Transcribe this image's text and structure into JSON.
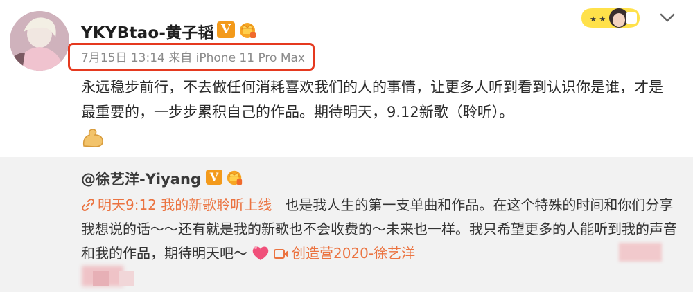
{
  "post": {
    "username": "YKYBtao-黄子韬",
    "verified_label": "V",
    "meta": "7月15日 13:14 来自 iPhone 11 Pro Max",
    "text": "永远稳步前行，不去做任何消耗喜欢我们的人的事情，让更多人听到看到认识你是谁，才是最重要的，一步步累积自己的作品。期待明天，9.12新歌（聆听）。",
    "emoji": "muscle-icon"
  },
  "repost": {
    "username": "@徐艺洋-Yiyang",
    "verified_label": "V",
    "link_text": "明天9:12 我的新歌聆听上线",
    "text": "也是我人生的第一支单曲和作品。在这个特殊的时间和你们分享我想说的话～～还有就是我的新歌也不会收费的～未来也一样。我只希望更多的人能听到我的声音和我的作品，期待明天吧～",
    "video_link": "创造营2020-徐艺洋"
  },
  "colors": {
    "accent": "#eb7340",
    "highlight": "#e5391f",
    "verified": "#f39a1b",
    "repost_bg": "#f2f2f2"
  }
}
